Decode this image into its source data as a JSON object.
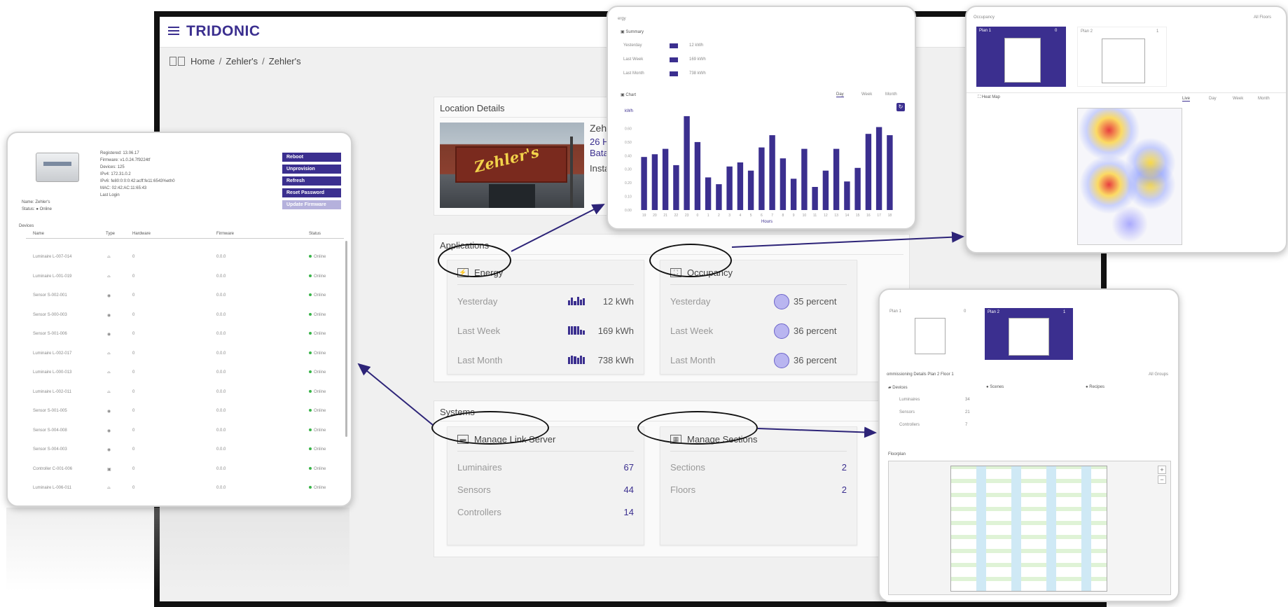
{
  "app": {
    "brand": "TRIDONIC",
    "breadcrumb": [
      "Home",
      "Zehler's",
      "Zehler's"
    ]
  },
  "location": {
    "title": "Location Details",
    "name": "Zehle",
    "address_line1": "26 Ha",
    "address_line2": "Batav",
    "installed": "Instal",
    "sign_text": "Zehler's"
  },
  "applications": {
    "title": "Applications",
    "energy": {
      "title": "Energy",
      "rows": [
        {
          "label": "Yesterday",
          "value": "12 kWh"
        },
        {
          "label": "Last Week",
          "value": "169 kWh"
        },
        {
          "label": "Last Month",
          "value": "738 kWh"
        }
      ]
    },
    "occupancy": {
      "title": "Occupancy",
      "rows": [
        {
          "label": "Yesterday",
          "value": "35 percent"
        },
        {
          "label": "Last Week",
          "value": "36 percent"
        },
        {
          "label": "Last Month",
          "value": "36 percent"
        }
      ]
    }
  },
  "systems": {
    "title": "Systems",
    "link_server": {
      "title": "Manage Link Server",
      "rows": [
        {
          "label": "Luminaires",
          "value": "67"
        },
        {
          "label": "Sensors",
          "value": "44"
        },
        {
          "label": "Controllers",
          "value": "14"
        }
      ]
    },
    "sections": {
      "title": "Manage Sections",
      "rows": [
        {
          "label": "Sections",
          "value": "2"
        },
        {
          "label": "Floors",
          "value": "2"
        }
      ]
    }
  },
  "device_popup": {
    "info": [
      "Registered: 13.06.17",
      "Firmware: v1.0.24.7f9224tf",
      "Devices: 125",
      "IPv4: 172.31.0.2",
      "IPv6: fe80:0:0:0:42:acff:fe11:6543%eth0",
      "MAC: 02:42:AC:11:65:43",
      "Last Login"
    ],
    "name_line": "Name: Zehler's",
    "status_line": "Status: ● Online",
    "buttons": [
      "Reboot",
      "Unprovision",
      "Refresh",
      "Reset Password",
      "Update Firmware"
    ],
    "devices_label": "Devices",
    "columns": [
      "Name",
      "Type",
      "Hardware",
      "Firmware",
      "Status"
    ],
    "rows": [
      {
        "name": "Luminaire L-007-014",
        "type": "lum",
        "hw": "0",
        "fw": "0.0.0",
        "status": "Online"
      },
      {
        "name": "Luminaire L-001-019",
        "type": "lum",
        "hw": "0",
        "fw": "0.0.0",
        "status": "Online"
      },
      {
        "name": "Sensor S-002-001",
        "type": "sen",
        "hw": "0",
        "fw": "0.0.0",
        "status": "Online"
      },
      {
        "name": "Sensor S-000-003",
        "type": "sen",
        "hw": "0",
        "fw": "0.0.0",
        "status": "Online"
      },
      {
        "name": "Sensor S-001-006",
        "type": "sen",
        "hw": "0",
        "fw": "0.0.0",
        "status": "Online"
      },
      {
        "name": "Luminaire L-002-017",
        "type": "lum",
        "hw": "0",
        "fw": "0.0.0",
        "status": "Online"
      },
      {
        "name": "Luminaire L-000-013",
        "type": "lum",
        "hw": "0",
        "fw": "0.0.0",
        "status": "Online"
      },
      {
        "name": "Luminaire L-002-011",
        "type": "lum",
        "hw": "0",
        "fw": "0.0.0",
        "status": "Online"
      },
      {
        "name": "Sensor S-001-005",
        "type": "sen",
        "hw": "0",
        "fw": "0.0.0",
        "status": "Online"
      },
      {
        "name": "Sensor S-004-008",
        "type": "sen",
        "hw": "0",
        "fw": "0.0.0",
        "status": "Online"
      },
      {
        "name": "Sensor S-004-003",
        "type": "sen",
        "hw": "0",
        "fw": "0.0.0",
        "status": "Online"
      },
      {
        "name": "Controller C-001-006",
        "type": "ctl",
        "hw": "0",
        "fw": "0.0.0",
        "status": "Online"
      },
      {
        "name": "Luminaire L-006-011",
        "type": "lum",
        "hw": "0",
        "fw": "0.0.0",
        "status": "Online"
      }
    ]
  },
  "energy_popup": {
    "summary_title": "Summary",
    "summary_rows": [
      {
        "label": "Yesterday",
        "value": "12 kWh"
      },
      {
        "label": "Last Week",
        "value": "169 kWh"
      },
      {
        "label": "Last Month",
        "value": "738 kWh"
      }
    ],
    "chart_title": "Chart",
    "tabs": [
      "Day",
      "Week",
      "Month"
    ]
  },
  "chart_data": {
    "type": "bar",
    "ylabel": "kWh",
    "xlabel": "Hours",
    "categories": [
      "19",
      "20",
      "21",
      "22",
      "23",
      "0",
      "1",
      "2",
      "3",
      "4",
      "5",
      "6",
      "7",
      "8",
      "9",
      "10",
      "11",
      "12",
      "13",
      "14",
      "15",
      "16",
      "17",
      "18"
    ],
    "values": [
      0.39,
      0.41,
      0.45,
      0.33,
      0.69,
      0.5,
      0.24,
      0.19,
      0.32,
      0.35,
      0.29,
      0.46,
      0.55,
      0.38,
      0.23,
      0.45,
      0.17,
      0.29,
      0.45,
      0.21,
      0.31,
      0.56,
      0.61,
      0.55
    ],
    "yticks": [
      "0.00",
      "0.10",
      "0.20",
      "0.30",
      "0.40",
      "0.50",
      "0.60"
    ],
    "ylim": [
      0,
      0.7
    ],
    "color": "#3b2f8f"
  },
  "occupancy_popup": {
    "header": "Occupancy",
    "all_floors": "All Floors",
    "plans": [
      {
        "label": "Plan 1",
        "count": "0"
      },
      {
        "label": "Plan 2",
        "count": "1"
      }
    ],
    "heatmap_title": "Heat Map",
    "tabs": [
      "Live",
      "Day",
      "Week",
      "Month"
    ]
  },
  "sections_popup": {
    "plans": [
      {
        "label": "Plan 1",
        "count": "0"
      },
      {
        "label": "Plan 2",
        "count": "1"
      }
    ],
    "breadcrumb": "ommissioning Details  Plan 2  Floor 1",
    "all_groups": "All Groups",
    "devices_title": "Devices",
    "scenes_title": "Scenes",
    "recipes_title": "Recipes",
    "device_counts": [
      {
        "label": "Luminaires",
        "value": "34"
      },
      {
        "label": "Sensors",
        "value": "21"
      },
      {
        "label": "Controllers",
        "value": "7"
      }
    ],
    "floorplan_title": "Floorplan"
  },
  "colors": {
    "brand": "#3b2f8f",
    "online": "#3bb44a",
    "occupancy_circle": "#b9b5f0"
  }
}
